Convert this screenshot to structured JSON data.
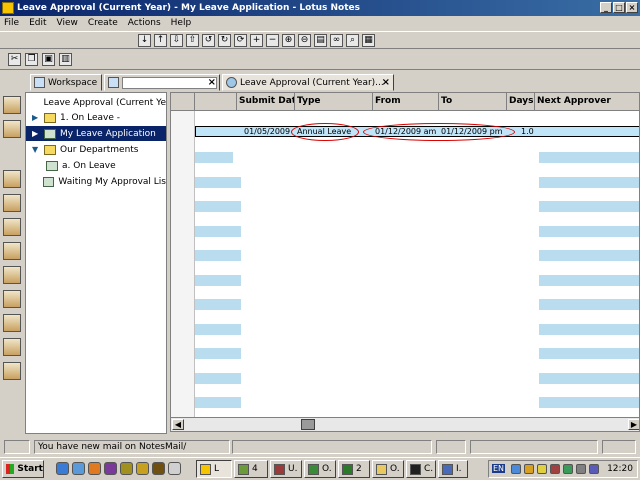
{
  "window": {
    "title": "Leave Approval (Current Year) - My Leave Application - Lotus Notes"
  },
  "menu": [
    "File",
    "Edit",
    "View",
    "Create",
    "Actions",
    "Help"
  ],
  "tabs": [
    {
      "label": "Workspace"
    },
    {
      "label": ""
    },
    {
      "label": "Leave Approval (Current Year)..."
    }
  ],
  "nav": {
    "items": [
      {
        "label": "Leave Approval (Current Ye",
        "kind": "root"
      },
      {
        "label": "1. On Leave -",
        "kind": "folder"
      },
      {
        "label": "My Leave Application",
        "kind": "view",
        "selected": true
      },
      {
        "label": "Our Departments",
        "kind": "folder-open"
      },
      {
        "label": "a. On Leave",
        "kind": "view"
      },
      {
        "label": "Waiting My Approval Lis",
        "kind": "view"
      }
    ]
  },
  "view": {
    "columns": [
      "Submit Date",
      "Type",
      "From",
      "To",
      "Days",
      "Next Approver"
    ],
    "rows": [
      {
        "submit_date": "01/05/2009",
        "type": "Annual Leave",
        "from": "01/12/2009 am",
        "to": "01/12/2009 pm",
        "days": "1.0",
        "next_approver": ""
      }
    ]
  },
  "status": {
    "message": "You have new mail on NotesMail/"
  },
  "taskbar": {
    "start": "Start",
    "buttons": [
      "L",
      "4",
      "U.",
      "O.",
      "2",
      "O.",
      "C.",
      "I."
    ],
    "clock": "12:20",
    "lang": "EN"
  }
}
